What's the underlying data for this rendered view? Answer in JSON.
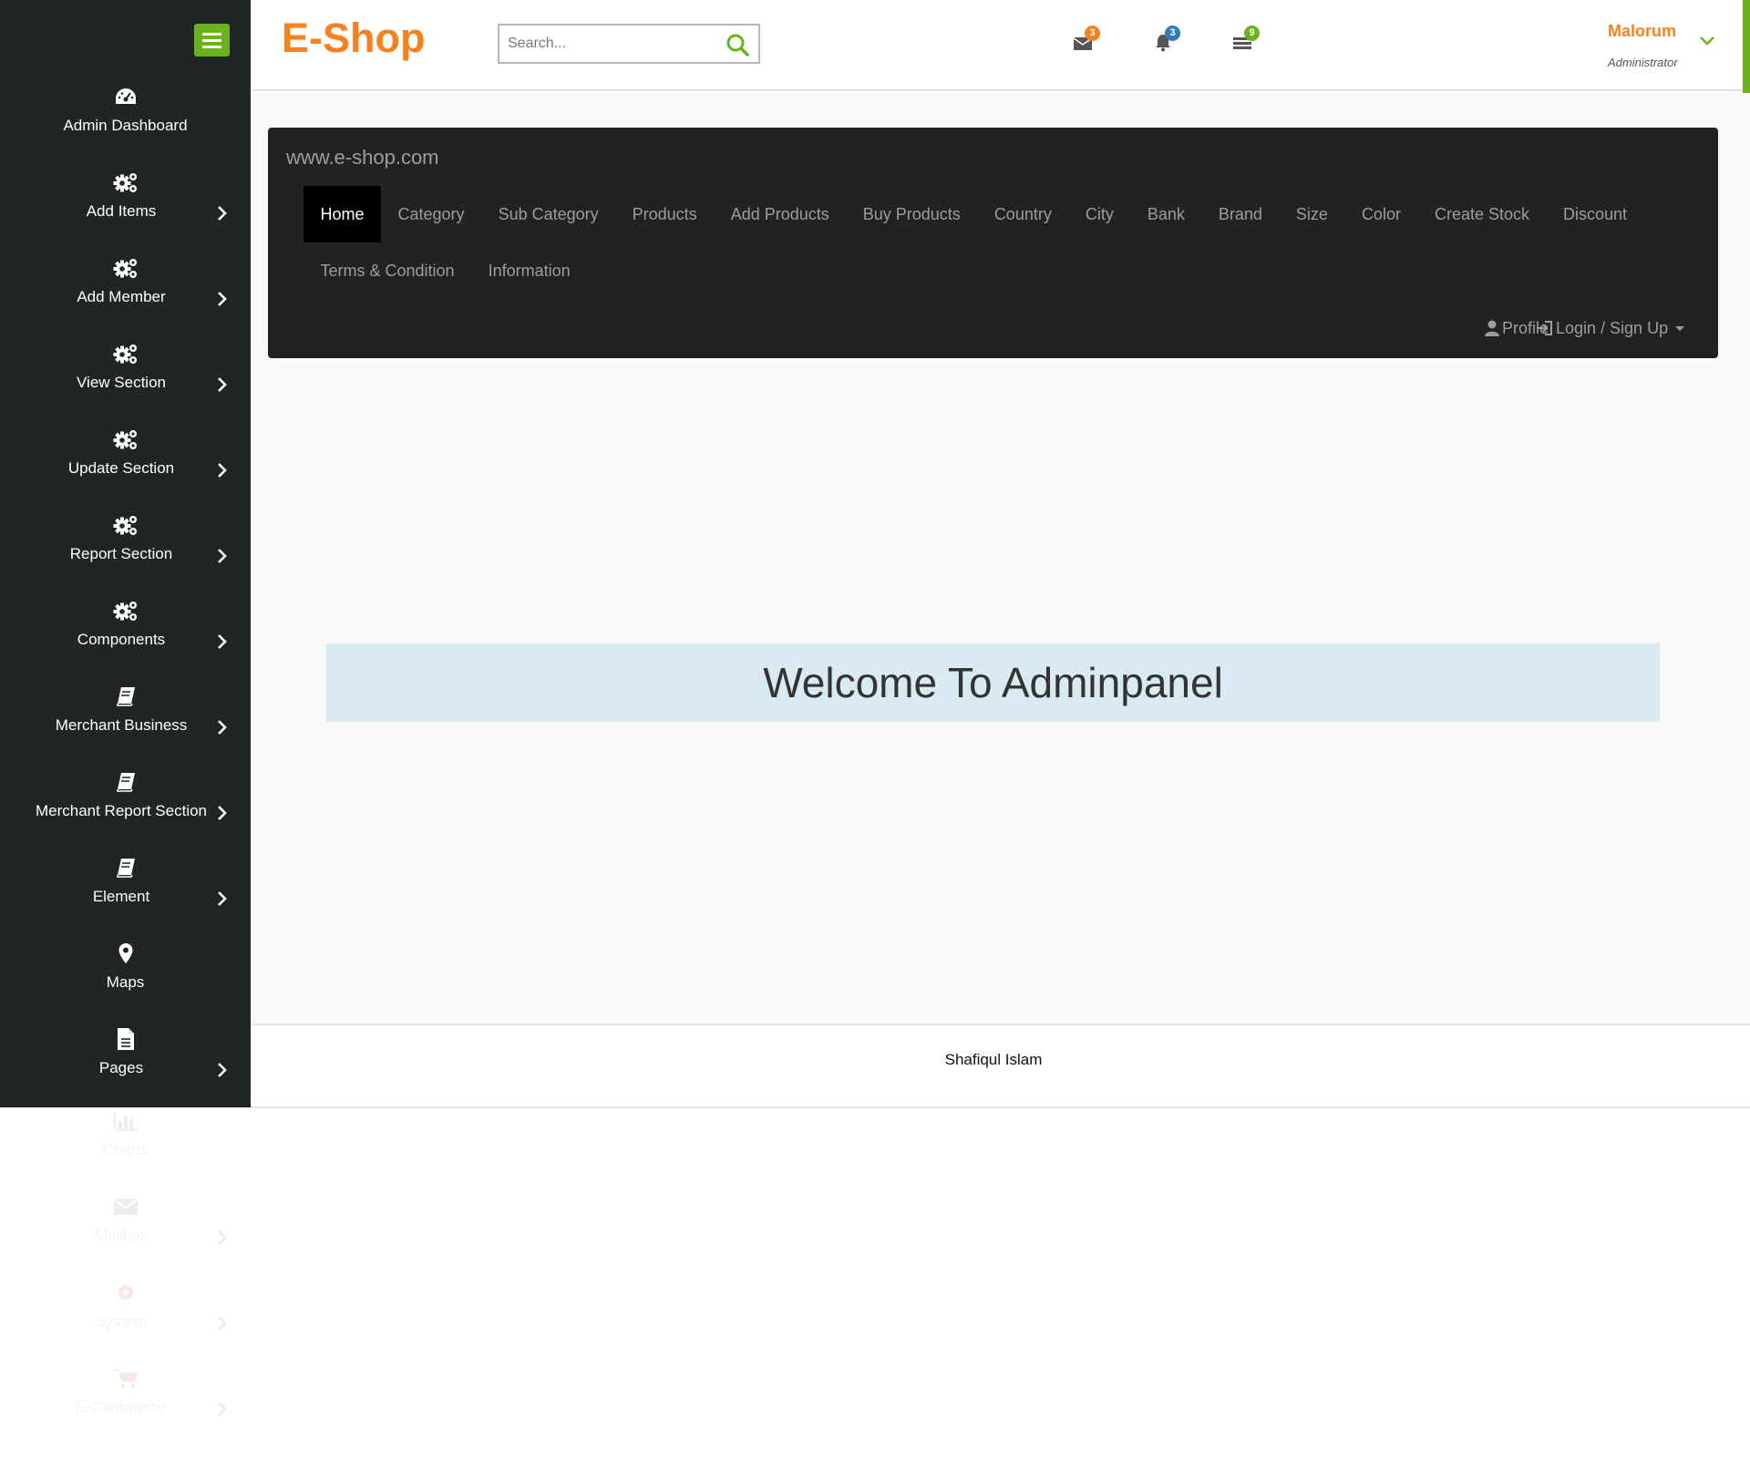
{
  "sidebar": {
    "items": [
      {
        "label": "Admin Dashboard",
        "icon": "dashboard-icon",
        "submenu": false
      },
      {
        "label": "Add Items",
        "icon": "cogs-icon",
        "submenu": true
      },
      {
        "label": "Add Member",
        "icon": "cogs-icon",
        "submenu": true
      },
      {
        "label": "View Section",
        "icon": "cogs-icon",
        "submenu": true
      },
      {
        "label": "Update Section",
        "icon": "cogs-icon",
        "submenu": true
      },
      {
        "label": "Report Section",
        "icon": "cogs-icon",
        "submenu": true
      },
      {
        "label": "Components",
        "icon": "cogs-icon",
        "submenu": true
      },
      {
        "label": "Merchant Business",
        "icon": "book-icon",
        "submenu": true
      },
      {
        "label": "Merchant Report Section",
        "icon": "book-icon",
        "submenu": true
      },
      {
        "label": "Element",
        "icon": "book-icon",
        "submenu": true
      },
      {
        "label": "Maps",
        "icon": "map-marker-icon",
        "submenu": false
      },
      {
        "label": "Pages",
        "icon": "file-icon",
        "submenu": true
      }
    ],
    "overflow_items": [
      {
        "label": "Charts",
        "icon": "bar-chart-icon",
        "submenu": false
      },
      {
        "label": "Mailbox",
        "icon": "envelope-icon",
        "submenu": true
      },
      {
        "label": "System",
        "icon": "gear-icon",
        "submenu": true
      },
      {
        "label": "E-Commerce",
        "icon": "cart-icon",
        "submenu": true
      }
    ]
  },
  "header": {
    "logo": "E-Shop",
    "search_placeholder": "Search...",
    "messages_count": "3",
    "notifications_count": "3",
    "tasks_count": "9",
    "user_name": "Malorum",
    "user_role": "Administrator"
  },
  "navbar": {
    "brand": "www.e-shop.com",
    "row1": [
      "Home",
      "Category",
      "Sub Category",
      "Products",
      "Add Products",
      "Buy Products",
      "Country",
      "City",
      "Bank",
      "Brand",
      "Size",
      "Color",
      "Create Stock",
      "Discount"
    ],
    "row2": [
      "Terms & Condition",
      "Information"
    ],
    "profile": "Profile",
    "login": "Login / Sign Up"
  },
  "main": {
    "welcome": "Welcome To Adminpanel"
  },
  "footer": {
    "text": "Shafiqul Islam"
  },
  "colors": {
    "accent_green": "#6bb31e",
    "brand_orange": "#f5821f",
    "sidebar_bg": "#222525",
    "navbar_bg": "#222222",
    "badge_blue": "#337ab7"
  }
}
